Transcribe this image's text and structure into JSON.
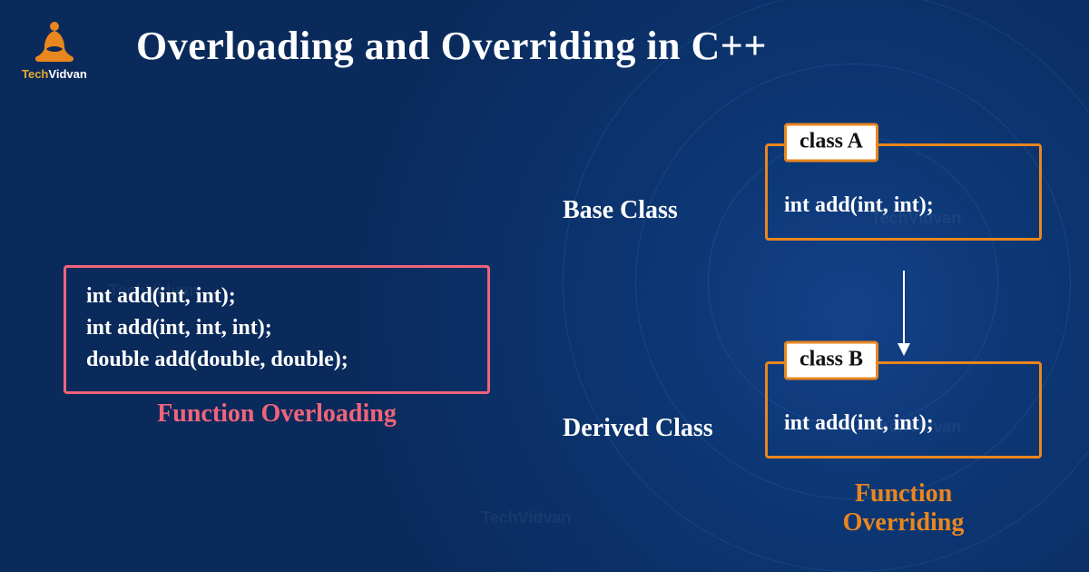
{
  "brand": {
    "tech": "Tech",
    "vidvan": "Vidvan"
  },
  "title": "Overloading and Overriding in C++",
  "overloading": {
    "lines": [
      "int add(int, int);",
      "int add(int, int, int);",
      "double add(double, double);"
    ],
    "caption": "Function Overloading"
  },
  "labels": {
    "base": "Base Class",
    "derived": "Derived Class"
  },
  "classA": {
    "tag": "class A",
    "body": "int add(int, int);"
  },
  "classB": {
    "tag": "class B",
    "body": "int add(int, int);"
  },
  "overriding_caption_line1": "Function",
  "overriding_caption_line2": "Overriding"
}
